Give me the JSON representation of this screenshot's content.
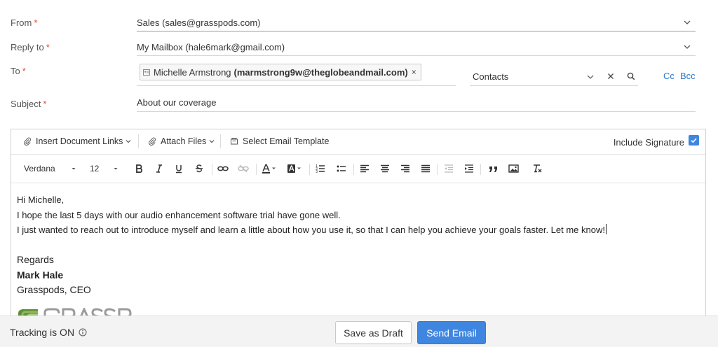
{
  "form": {
    "from": {
      "label": "From",
      "required_mark": "*",
      "value": "Sales (sales@grasspods.com)"
    },
    "reply_to": {
      "label": "Reply to",
      "required_mark": "*",
      "value": "My Mailbox (hale6mark@gmail.com)"
    },
    "to": {
      "label": "To",
      "required_mark": "*",
      "recipient_name": "Michelle Armstrong",
      "recipient_email": "(marmstrong9w@theglobeandmail.com)",
      "remove_glyph": "×",
      "contacts_placeholder": "Contacts",
      "cc_label": "Cc",
      "bcc_label": "Bcc"
    },
    "subject": {
      "label": "Subject",
      "required_mark": "*",
      "value": "About our coverage"
    }
  },
  "toolbar": {
    "insert_links": "Insert Document Links",
    "attach_files": "Attach Files",
    "select_template": "Select Email Template",
    "include_signature": "Include Signature",
    "include_signature_checked": true,
    "font_family": "Verdana",
    "font_size": "12"
  },
  "message": {
    "greeting": "Hi Michelle,",
    "line1": "I hope the last 5 days with our audio enhancement software trial have gone well.",
    "line2": "I just wanted to reach out to introduce myself and learn a little about how you use it, so that I can help you achieve your goals faster. Let me know!",
    "closing": "Regards",
    "sender_name": "Mark Hale",
    "sender_title": "Grasspods, CEO"
  },
  "footer": {
    "tracking_text": "Tracking is ON",
    "save_draft": "Save as Draft",
    "send_email": "Send Email"
  },
  "colors": {
    "accent": "#3f86e0",
    "required": "#e04a3a",
    "link": "#2a79c9",
    "logo_green": "#6a9a3a"
  }
}
